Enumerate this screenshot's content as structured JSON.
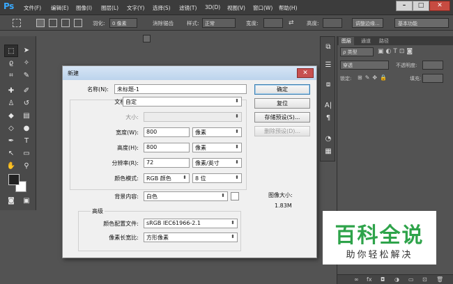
{
  "app": {
    "logo": "Ps"
  },
  "menu": [
    "文件(F)",
    "编辑(E)",
    "图像(I)",
    "图层(L)",
    "文字(Y)",
    "选择(S)",
    "滤镜(T)",
    "3D(D)",
    "视图(V)",
    "窗口(W)",
    "帮助(H)"
  ],
  "window_controls": {
    "minimize": "–",
    "maximize": "□",
    "close": "✕"
  },
  "options": {
    "feather_label": "羽化:",
    "feather_value": "0 像素",
    "antialias_label": "消除锯齿",
    "style_label": "样式:",
    "style_value": "正常",
    "width_label": "宽度:",
    "height_label": "高度:",
    "refine_edge": "调整边缘...",
    "workspace": "基本功能"
  },
  "dialog": {
    "title": "新建",
    "name_label": "名称(N):",
    "name_value": "未标题-1",
    "preset_label": "文档类型:",
    "preset_value": "自定",
    "size_label": "大小:",
    "width_label": "宽度(W):",
    "width_value": "800",
    "width_unit": "像素",
    "height_label": "高度(H):",
    "height_value": "800",
    "height_unit": "像素",
    "resolution_label": "分辨率(R):",
    "resolution_value": "72",
    "resolution_unit": "像素/英寸",
    "color_mode_label": "颜色模式:",
    "color_mode_value": "RGB 颜色",
    "bit_depth_value": "8 位",
    "background_label": "背景内容:",
    "background_value": "白色",
    "advanced_label": "高级",
    "profile_label": "颜色配置文件:",
    "profile_value": "sRGB IEC61966-2.1",
    "pixel_aspect_label": "像素长宽比:",
    "pixel_aspect_value": "方形像素",
    "image_size_label": "图像大小:",
    "image_size_value": "1.83M",
    "buttons": {
      "ok": "确定",
      "cancel": "复位",
      "save_preset": "存储预设(S)...",
      "delete_preset": "删除预设(D)..."
    }
  },
  "layers_panel": {
    "tabs": [
      "图层",
      "通道",
      "路径"
    ],
    "filter_label": "ρ 类型",
    "blend_mode": "穿透",
    "opacity_label": "不透明度:",
    "lock_label": "锁定:",
    "fill_label": "填充:"
  },
  "watermark": {
    "title": "百科全说",
    "subtitle": "助你轻松解决"
  },
  "colors": {
    "accent": "#38a9ff",
    "watermark_green": "#2ea34a"
  }
}
